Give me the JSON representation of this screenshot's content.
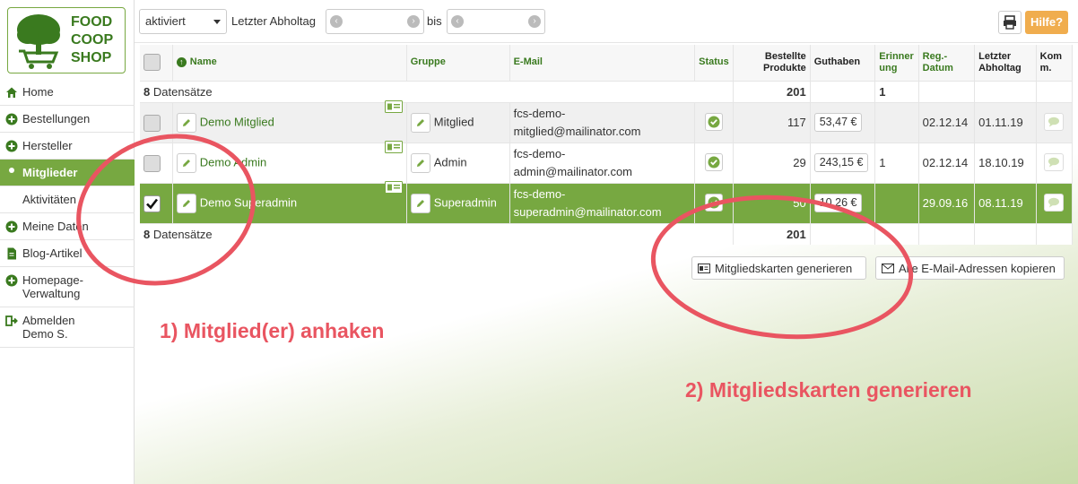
{
  "logo": {
    "line1": "FOOD",
    "line2": "COOP",
    "line3": "SHOP"
  },
  "sidebar": {
    "items": [
      {
        "label": "Home",
        "icon": "home-icon",
        "active": false
      },
      {
        "label": "Bestellungen",
        "icon": "plus-circle-icon",
        "active": false
      },
      {
        "label": "Hersteller",
        "icon": "plus-circle-icon",
        "active": false
      },
      {
        "label": "Mitglieder",
        "icon": "user-icon",
        "active": true
      },
      {
        "label": "Aktivitäten",
        "icon": "eye-icon",
        "active": false
      },
      {
        "label": "Meine Daten",
        "icon": "plus-circle-icon",
        "active": false
      },
      {
        "label": "Blog-Artikel",
        "icon": "file-icon",
        "active": false
      },
      {
        "label": "Homepage-\nVerwaltung",
        "icon": "plus-circle-icon",
        "active": false
      },
      {
        "label": "Abmelden\nDemo S.",
        "icon": "sign-out-icon",
        "active": false
      }
    ]
  },
  "filters": {
    "status_value": "aktiviert",
    "last_pickup_label": "Letzter Abholtag",
    "bis_label": "bis",
    "date_from": "",
    "date_to": ""
  },
  "header_buttons": {
    "help_label": "Hilfe?"
  },
  "table": {
    "headers": {
      "name": "Name",
      "gruppe": "Gruppe",
      "email": "E-Mail",
      "status": "Status",
      "bestellte": "Bestellte Produkte",
      "guthaben": "Guthaben",
      "erinnerung": "Erinner ung",
      "reg": "Reg.-Datum",
      "letzter": "Letzter Abholtag",
      "komm": "Kom m."
    },
    "top_summary": {
      "count": "8",
      "count_label": "Datensätze",
      "bestellte": "201",
      "erinnerung": "1"
    },
    "rows": [
      {
        "name": "Demo Mitglied",
        "group": "Mitglied",
        "email_line1": "fcs-demo-",
        "email_line2": "mitglied@mailinator.com",
        "bestellte": "117",
        "guthaben": "53,47 €",
        "erinnerung": "",
        "reg": "02.12.14",
        "letzter": "01.11.19",
        "checked": false
      },
      {
        "name": "Demo Admin",
        "group": "Admin",
        "email_line1": "fcs-demo-",
        "email_line2": "admin@mailinator.com",
        "bestellte": "29",
        "guthaben": "243,15 €",
        "erinnerung": "1",
        "reg": "02.12.14",
        "letzter": "18.10.19",
        "checked": false
      },
      {
        "name": "Demo Superadmin",
        "group": "Superadmin",
        "email_line1": "fcs-demo-",
        "email_line2": "superadmin@mailinator.com",
        "bestellte": "50",
        "guthaben": "10,26 €",
        "erinnerung": "",
        "reg": "29.09.16",
        "letzter": "08.11.19",
        "checked": true
      }
    ],
    "bottom_summary": {
      "count": "8",
      "count_label": "Datensätze",
      "bestellte": "201"
    }
  },
  "actions": {
    "cards_button": "Mitgliedskarten generieren",
    "copy_emails_button": "Alle E-Mail-Adressen kopieren"
  },
  "annotations": {
    "step1": "1) Mitglied(er) anhaken",
    "step2": "2) Mitgliedskarten generieren",
    "color": "#e95561"
  },
  "colors": {
    "brand_green": "#77a841",
    "help_orange": "#f0ad4e"
  }
}
